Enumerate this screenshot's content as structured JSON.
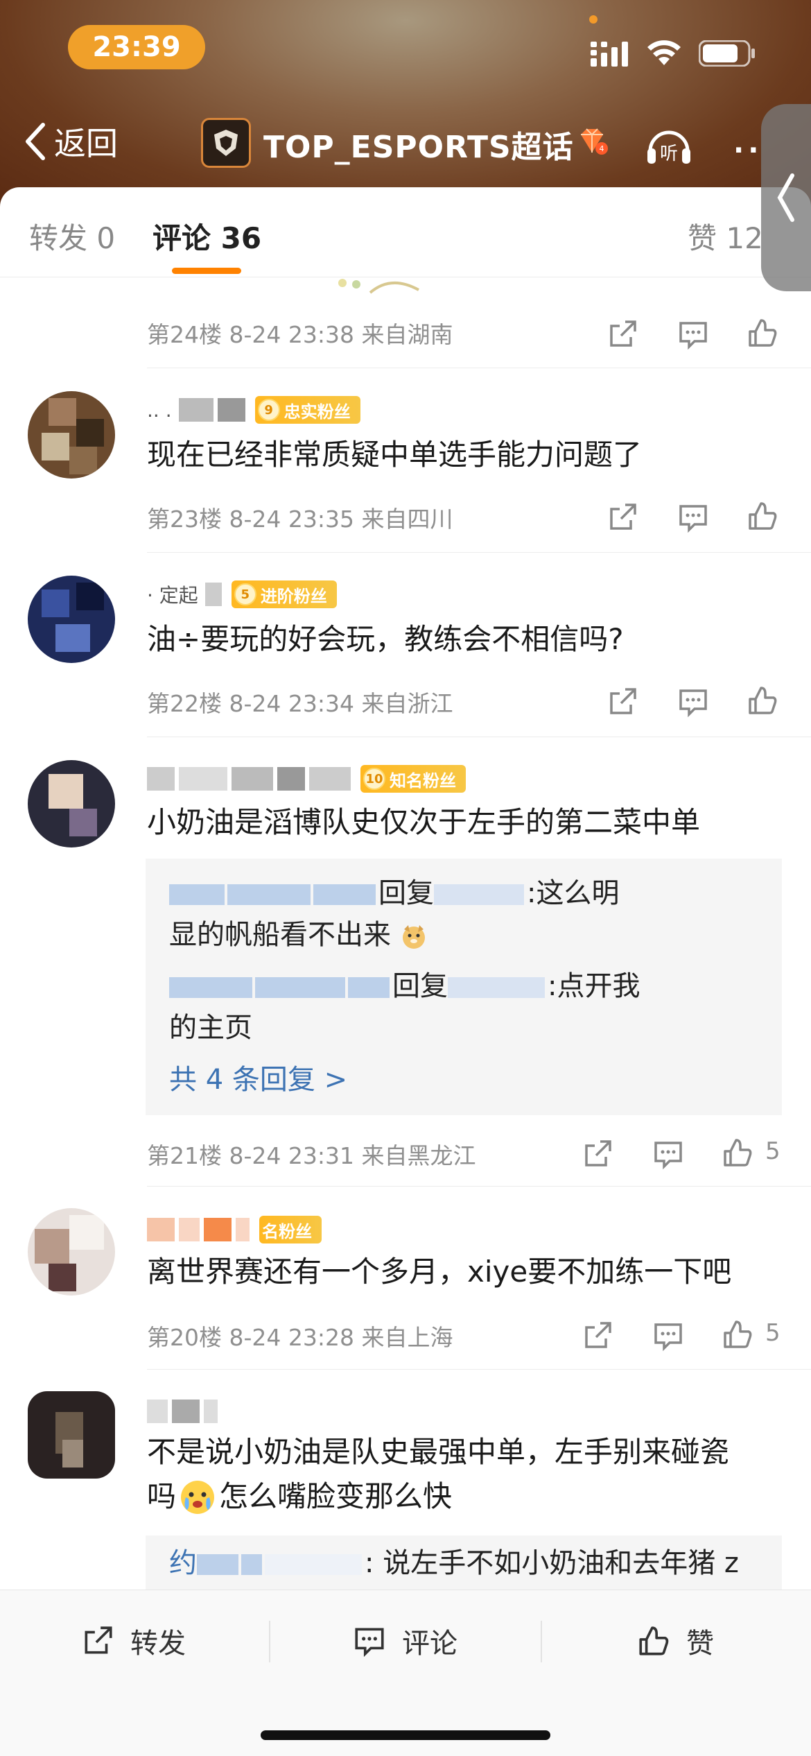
{
  "status": {
    "time": "23:39"
  },
  "nav": {
    "back_label": "返回",
    "title": "TOP_ESPORTS超话",
    "listen_label": "听",
    "more_label": "··"
  },
  "tabs": {
    "repost": "转发 0",
    "comment": "评论 36",
    "like": "赞 12"
  },
  "comments": [
    {
      "text": "",
      "meta": "第24楼 8-24 23:38 来自湖南",
      "likes": ""
    },
    {
      "name_visible": ".. .",
      "badge_level": "9",
      "badge_label": "忠实粉丝",
      "text": "现在已经非常质疑中单选手能力问题了",
      "meta": "第23楼 8-24 23:35 来自四川",
      "likes": ""
    },
    {
      "name_visible": "· 定起",
      "badge_level": "5",
      "badge_label": "进阶粉丝",
      "text": "油÷要玩的好会玩，教练会不相信吗?",
      "meta": "第22楼 8-24 23:34 来自浙江",
      "likes": ""
    },
    {
      "name_visible": "",
      "badge_level": "10",
      "badge_label": "知名粉丝",
      "text": "小奶油是滔博队史仅次于左手的第二菜中单",
      "replies": [
        {
          "line1": "回复",
          "line1_tail": ":这么明",
          "line2": "显的帆船看不出来"
        },
        {
          "line1": "回复",
          "line1_tail": ":点开我",
          "line2": "的主页"
        }
      ],
      "more_replies": "共 4 条回复 >",
      "meta": "第21楼 8-24 23:31 来自黑龙江",
      "likes": "5"
    },
    {
      "name_visible": "",
      "badge_level": "",
      "badge_label": "名粉丝",
      "text": "离世界赛还有一个多月，xiye要不加练一下吧",
      "meta": "第20楼 8-24 23:28 来自上海",
      "likes": "5"
    },
    {
      "name_visible": "",
      "badge_level": "",
      "badge_label": "",
      "text_line1": "不是说小奶油是队史最强中单，左手别来碰瓷",
      "text_line2": "怎么嘴脸变那么快",
      "text_prefix": "吗",
      "reply_preview": ": 说左手不如小奶油和去年猪 z",
      "reply_prefix": "约",
      "meta": "",
      "likes": ""
    }
  ],
  "bottom_bar": {
    "repost": "转发",
    "comment": "评论",
    "like": "赞"
  },
  "colors": {
    "accent": "#ff8200",
    "badge": "#ffb821",
    "link": "#3d73b3",
    "time_pill": "#f0a02a"
  }
}
